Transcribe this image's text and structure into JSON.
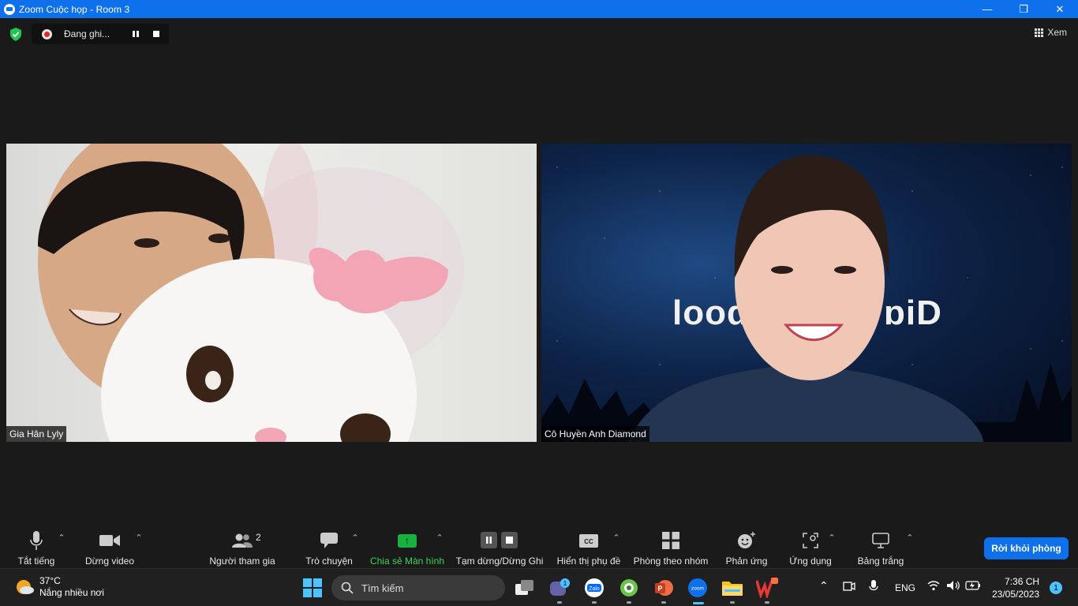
{
  "window": {
    "title": "Zoom Cuộc họp - Room 3",
    "controls": {
      "minimize": "—",
      "maximize": "❐",
      "close": "✕"
    }
  },
  "meeting_bar": {
    "recording_label": "Đang ghi...",
    "view_label": "Xem"
  },
  "videos": [
    {
      "participant": "Gia Hân Lyly"
    },
    {
      "participant": "Cô Huyền Anh Diamond",
      "background_text": "Diamond School (mirrored)"
    }
  ],
  "toolbar": {
    "mute": "Tắt tiếng",
    "video": "Dừng video",
    "participants": "Người tham gia",
    "participants_count": "2",
    "chat": "Trò chuyện",
    "share": "Chia sẻ Màn hình",
    "recording": "Tạm dừng/Dừng Ghi",
    "captions": "Hiển thị phụ đề",
    "breakout": "Phòng theo nhóm",
    "reactions": "Phản ứng",
    "apps": "Ứng dụng",
    "whiteboard": "Bảng trắng",
    "leave": "Rời khỏi phòng"
  },
  "taskbar": {
    "weather_temp": "37°C",
    "weather_desc": "Nắng nhiều nơi",
    "search_placeholder": "Tìm kiếm",
    "meet_badge": "1",
    "language": "ENG",
    "time": "7:36 CH",
    "date": "23/05/2023",
    "notification_count": "1"
  },
  "colors": {
    "zoom_blue": "#0e71eb",
    "share_green": "#16b33e",
    "toolbar_bg": "#1a1a1a",
    "taskbar_bg": "#202020"
  }
}
